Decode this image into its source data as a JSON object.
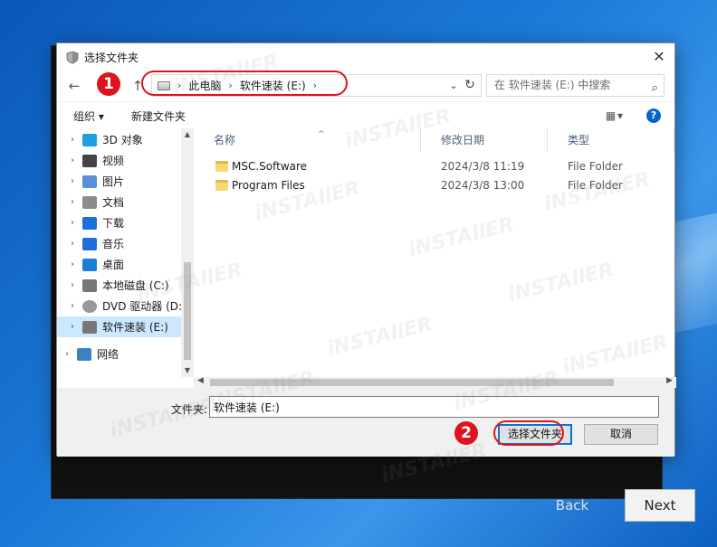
{
  "dialog": {
    "title": "选择文件夹",
    "close_glyph": "✕"
  },
  "nav": {
    "back_glyph": "←",
    "forward_glyph": "→",
    "up_glyph": "↑",
    "breadcrumb": [
      "此电脑",
      "软件速装 (E:)"
    ],
    "breadcrumb_sep": "›",
    "dropdown_glyph": "⌄",
    "refresh_glyph": "↻",
    "search_placeholder": "在 软件速装 (E:) 中搜索",
    "search_glyph": "⌕"
  },
  "toolbar": {
    "organize_label": "组织 ▾",
    "new_folder_label": "新建文件夹",
    "view_glyph": "▦ ▾",
    "help_glyph": "?"
  },
  "navpane": {
    "items": [
      {
        "label": "3D 对象",
        "icon": "cube-icon",
        "color": "#1ba1e2"
      },
      {
        "label": "视频",
        "icon": "video-icon",
        "color": "#444444"
      },
      {
        "label": "图片",
        "icon": "picture-icon",
        "color": "#5b8fd6"
      },
      {
        "label": "文档",
        "icon": "document-icon",
        "color": "#8c8c8c"
      },
      {
        "label": "下载",
        "icon": "download-icon",
        "color": "#1e6fd9"
      },
      {
        "label": "音乐",
        "icon": "music-icon",
        "color": "#1e6fd9"
      },
      {
        "label": "桌面",
        "icon": "desktop-icon",
        "color": "#1a7fd6"
      },
      {
        "label": "本地磁盘 (C:)",
        "icon": "local-disk-icon",
        "color": "#777777"
      },
      {
        "label": "DVD 驱动器 (D:",
        "icon": "dvd-icon",
        "color": "#999999"
      },
      {
        "label": "软件速装 (E:)",
        "icon": "drive-icon",
        "color": "#777777",
        "selected": true
      },
      {
        "label": "网络",
        "icon": "network-icon",
        "color": "#3b82c4"
      }
    ],
    "chevron_glyph": "›"
  },
  "filelist": {
    "columns": [
      "名称",
      "修改日期",
      "类型"
    ],
    "rows": [
      {
        "name": "MSC.Software",
        "date": "2024/3/8 11:19",
        "type": "File Folder"
      },
      {
        "name": "Program Files",
        "date": "2024/3/8 13:00",
        "type": "File Folder"
      }
    ]
  },
  "bottom": {
    "folder_label": "文件夹:",
    "folder_value": "软件速装 (E:)",
    "select_button": "选择文件夹",
    "cancel_button": "取消"
  },
  "installer": {
    "back_label": "Back",
    "next_label": "Next"
  },
  "annotations": {
    "step1": "1",
    "step2": "2",
    "color": "#e0121e"
  },
  "watermark_text": "iNSTAllER"
}
